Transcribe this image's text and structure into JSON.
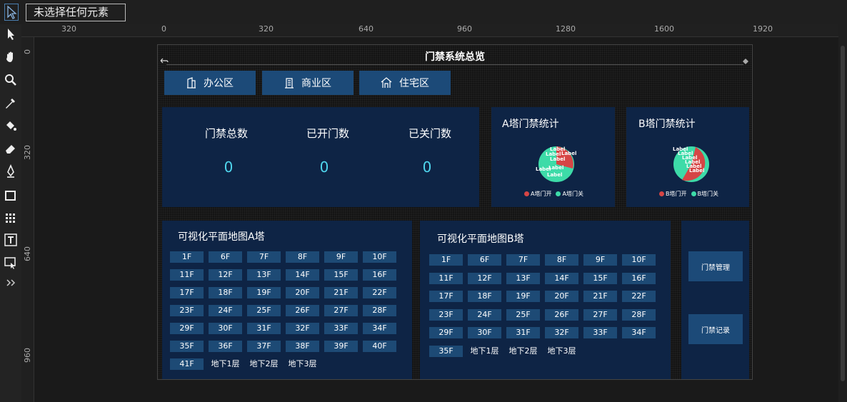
{
  "editor": {
    "status": "未选择任何元素",
    "ruler_h": [
      "320",
      "0",
      "320",
      "640",
      "960",
      "1280",
      "1600",
      "1920"
    ],
    "ruler_v": [
      "0",
      "320",
      "640",
      "960"
    ]
  },
  "dashboard": {
    "title": "门禁系统总览",
    "zones": [
      {
        "label": "办公区",
        "icon": "office-building-icon"
      },
      {
        "label": "商业区",
        "icon": "commercial-building-icon"
      },
      {
        "label": "住宅区",
        "icon": "house-icon"
      }
    ],
    "stats": [
      {
        "label": "门禁总数",
        "value": "0"
      },
      {
        "label": "已开门数",
        "value": "0"
      },
      {
        "label": "已关门数",
        "value": "0"
      }
    ],
    "charts": [
      {
        "title": "A塔门禁统计",
        "legend_open": "A塔门开",
        "legend_closed": "A塔门关",
        "slice_label": "Label"
      },
      {
        "title": "B塔门禁统计",
        "legend_open": "B塔门开",
        "legend_closed": "B塔门关",
        "slice_label": "Label"
      }
    ],
    "colors": {
      "open": "#d64545",
      "closed": "#3ddba8",
      "accent": "#4fd6ee"
    },
    "mapA": {
      "title": "可视化平面地图A塔",
      "floors": [
        "1F",
        "6F",
        "7F",
        "8F",
        "9F",
        "10F",
        "11F",
        "12F",
        "13F",
        "14F",
        "15F",
        "16F",
        "17F",
        "18F",
        "19F",
        "20F",
        "21F",
        "22F",
        "23F",
        "24F",
        "25F",
        "26F",
        "27F",
        "28F",
        "29F",
        "30F",
        "31F",
        "32F",
        "33F",
        "34F",
        "35F",
        "36F",
        "37F",
        "38F",
        "39F",
        "40F",
        "41F",
        "地下1层",
        "地下2层",
        "地下3层"
      ]
    },
    "mapB": {
      "title": "可视化平面地图B塔",
      "floors": [
        "1F",
        "6F",
        "7F",
        "8F",
        "9F",
        "10F",
        "11F",
        "12F",
        "13F",
        "14F",
        "15F",
        "16F",
        "17F",
        "18F",
        "19F",
        "20F",
        "21F",
        "22F",
        "23F",
        "24F",
        "25F",
        "26F",
        "27F",
        "28F",
        "29F",
        "30F",
        "31F",
        "32F",
        "33F",
        "34F",
        "35F",
        "地下1层",
        "地下2层",
        "地下3层"
      ]
    },
    "actions": [
      "门禁管理",
      "门禁记录"
    ]
  }
}
